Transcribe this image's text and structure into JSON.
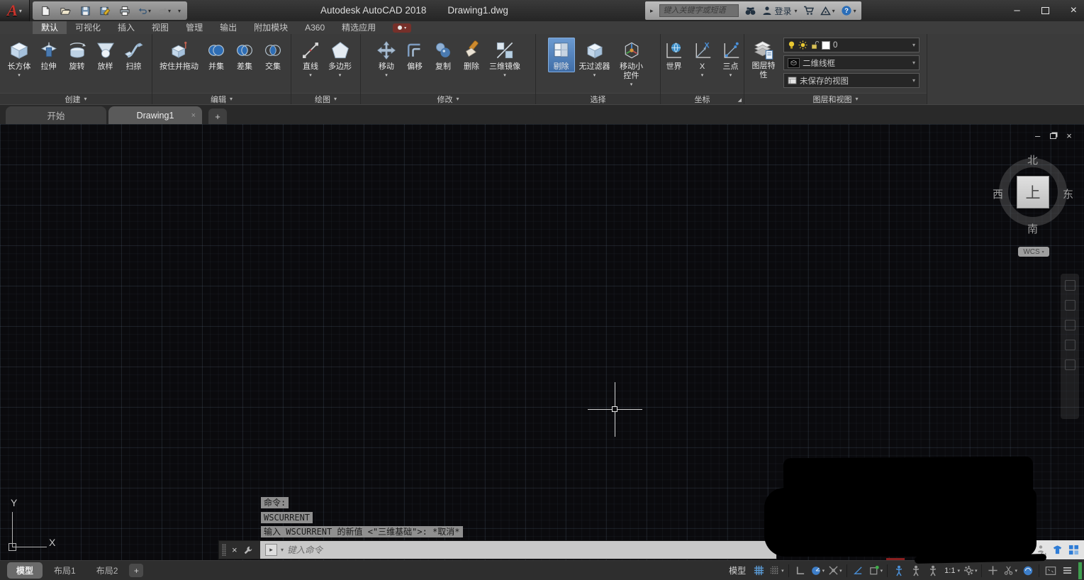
{
  "icons": {
    "caret_down": "▾",
    "caret_right": "▸",
    "close": "×",
    "minimize": "–",
    "plus": "+",
    "menu_glyph": "≡",
    "question": "?",
    "corner_launcher": "◢"
  },
  "titlebar": {
    "app_title": "Autodesk AutoCAD 2018",
    "doc_title": "Drawing1.dwg",
    "search_placeholder": "键入关键字或短语",
    "signin_label": "登录"
  },
  "ribbon": {
    "tabs": [
      "默认",
      "可视化",
      "插入",
      "视图",
      "管理",
      "输出",
      "附加模块",
      "A360",
      "精选应用"
    ],
    "panels": [
      {
        "label": "创建",
        "buttons": [
          "长方体",
          "拉伸",
          "旋转",
          "放样",
          "扫掠"
        ]
      },
      {
        "label": "编辑",
        "buttons": [
          "按住并拖动",
          "并集",
          "差集",
          "交集"
        ]
      },
      {
        "label": "绘图",
        "buttons": [
          "直线",
          "多边形"
        ]
      },
      {
        "label": "修改",
        "buttons": [
          "移动",
          "偏移",
          "复制",
          "删除",
          "三维镜像"
        ]
      },
      {
        "label": "选择",
        "buttons": [
          "剔除",
          "无过滤器",
          "移动小控件"
        ]
      },
      {
        "label": "坐标",
        "buttons": [
          "世界",
          "X",
          "三点"
        ]
      },
      {
        "label": "图层和视图",
        "buttons": [
          "图层特性"
        ],
        "layer_name": "0",
        "visual_style": "二维线框",
        "view_name": "未保存的视图"
      }
    ]
  },
  "file_tabs": {
    "start": "开始",
    "drawing": "Drawing1"
  },
  "viewcube": {
    "north": "北",
    "south": "南",
    "west": "西",
    "east": "东",
    "top": "上",
    "wcs": "WCS"
  },
  "command": {
    "history": [
      "命令:",
      "WSCURRENT",
      "输入 WSCURRENT 的新值 <\"三维基础\">: *取消*"
    ],
    "placeholder": "键入命令"
  },
  "layout_tabs": {
    "model": "模型",
    "layout1": "布局1",
    "layout2": "布局2"
  },
  "statusbar": {
    "model_label": "模型",
    "annotation_scale": "1:1"
  },
  "ucs": {
    "x_label": "X",
    "y_label": "Y"
  },
  "colors": {
    "accent_blue": "#4a90d9",
    "highlight_blue": "#3e6ca6",
    "canvas_bg": "#0a0a0d",
    "ribbon_bg": "#3b3b3b"
  }
}
